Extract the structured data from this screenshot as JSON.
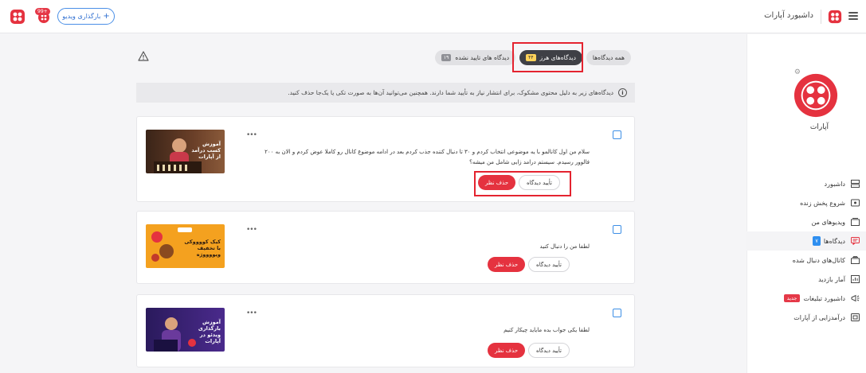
{
  "topbar": {
    "title": "داشبورد آپارات",
    "upload_label": "بارگذاری ویدیو",
    "notification_count": "99+"
  },
  "sidebar": {
    "channel_name": "آپارات",
    "items": [
      {
        "label": "داشبورد",
        "icon": "dashboard-icon"
      },
      {
        "label": "شروع پخش زنده",
        "icon": "live-icon"
      },
      {
        "label": "ویدیوهای من",
        "icon": "video-icon"
      },
      {
        "label": "دیدگاه‌ها",
        "icon": "comment-icon",
        "badge": "۷",
        "active": true
      },
      {
        "label": "کانال‌های دنبال شده",
        "icon": "channels-icon"
      },
      {
        "label": "آمار بازدید",
        "icon": "stats-icon"
      },
      {
        "label": "داشبورد تبلیغات",
        "icon": "ads-icon",
        "badge": "جدید"
      },
      {
        "label": "درآمدزایی از آپارات",
        "icon": "income-icon"
      }
    ]
  },
  "tabs": [
    {
      "label": "همه دیدگاه‌ها",
      "badge": ""
    },
    {
      "label": "دیدگاه‌های هرز",
      "badge": "۴۴",
      "active": true
    },
    {
      "label": "دیدگاه های تایید نشده",
      "badge": "۱۹"
    }
  ],
  "info_text": "دیدگاه‌های زیر به دلیل محتوی مشکوک، برای انتشار نیاز به تأیید شما دارند. همچنین می‌توانید آن‌ها به صورت تکی یا یک‌جا حذف کنید.",
  "comments": [
    {
      "text": "سلام من اول کانالمو با یه موضوعی انتخاب کردم و ۳۰ تا دنبال کننده جذب کردم بعد در ادامه موضوع کانال رو کاملا عوض کردم و الان به ۲۰۰ فالوور رسیدم. سیستم درامد زایی شامل من میشه؟",
      "thumb_text": "آموزش کسب درآمد از آپارات"
    },
    {
      "text": "لطفا من را دنبال کنید",
      "thumb_text": "کیک کووووکی با تخفیف ویووووژه"
    },
    {
      "text": "لطفا یکی جواب بده مایاید چیکار کنیم",
      "thumb_text": "آموزش بارگذاری ویدئو در آپارات"
    }
  ],
  "buttons": {
    "approve": "تأیید دیدگاه",
    "delete": "حذف نظر"
  },
  "colors": {
    "brand": "#e5323f",
    "accent": "#2f8ff0"
  }
}
